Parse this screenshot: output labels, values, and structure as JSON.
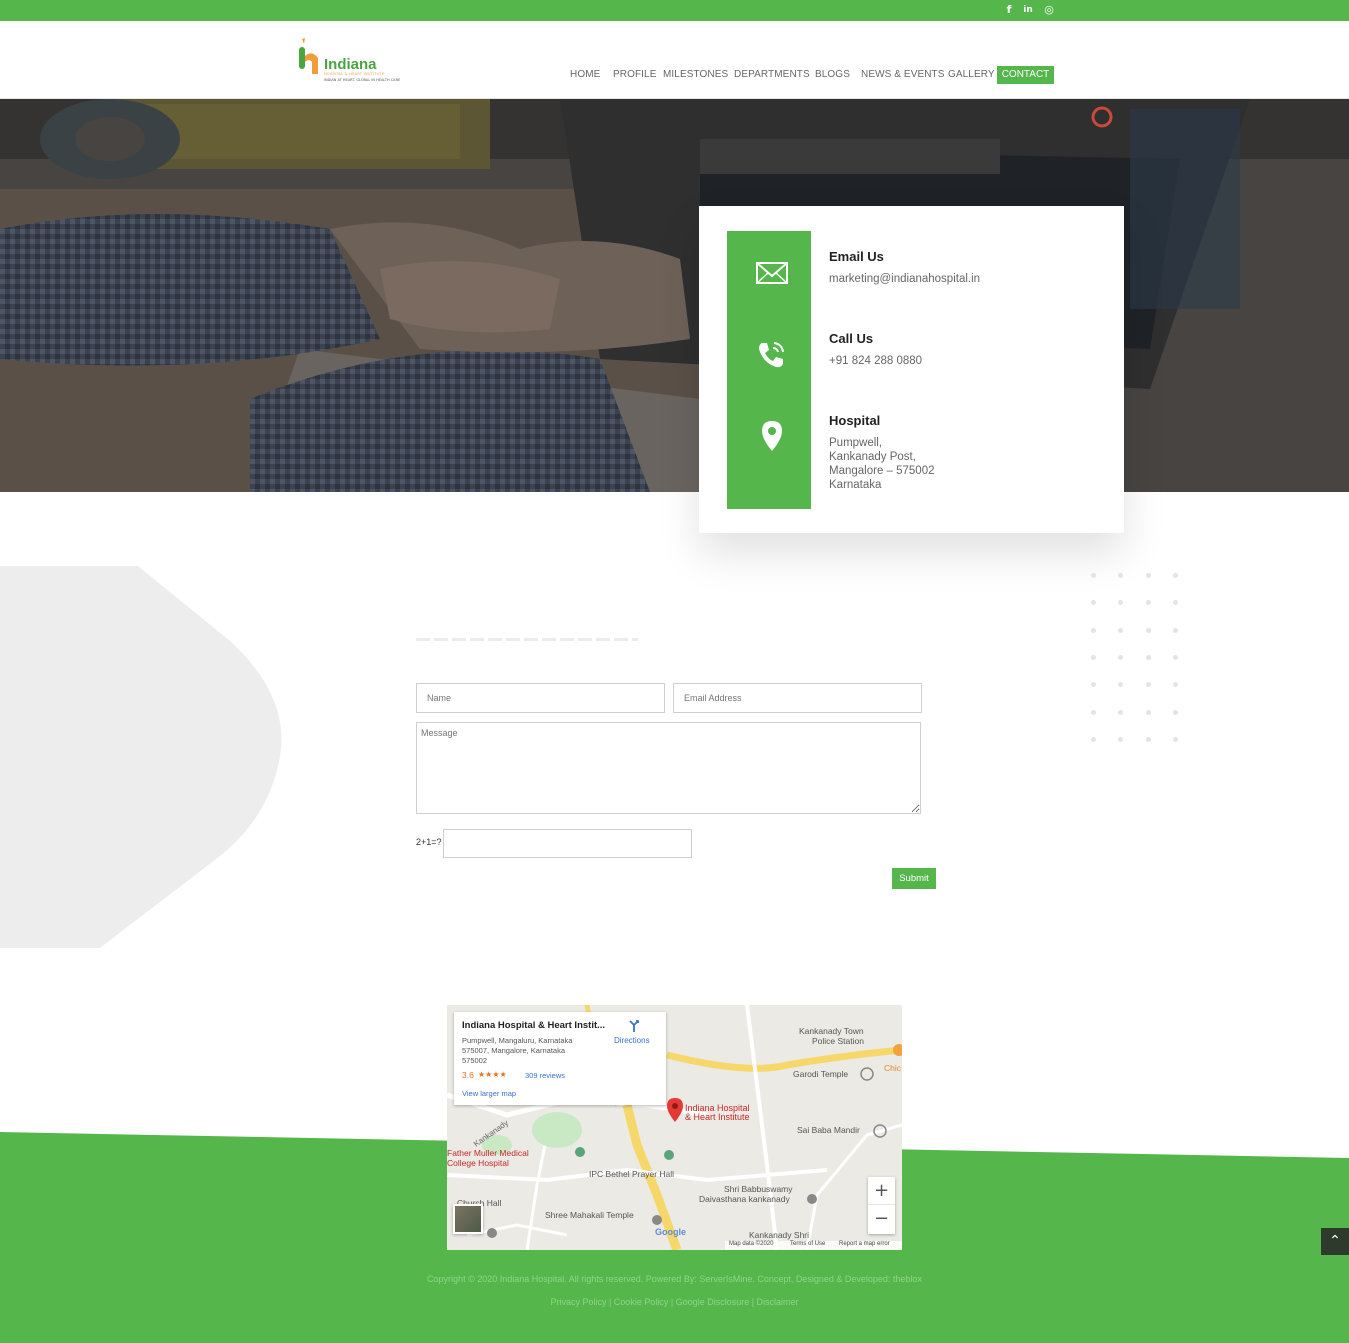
{
  "topbar": {
    "social": [
      {
        "icon": "facebook-icon",
        "glyph": "f"
      },
      {
        "icon": "linkedin-icon",
        "glyph": "in"
      },
      {
        "icon": "instagram-icon",
        "glyph": "◎"
      }
    ]
  },
  "brand": {
    "name": "Indiana",
    "subtitle": "HOSPITAL & HEART INSTITUTE",
    "tagline": "INDIAN AT HEART. GLOBAL IN HEALTH CARE"
  },
  "nav": {
    "items": [
      "HOME",
      "PROFILE",
      "MILESTONES",
      "DEPARTMENTS",
      "BLOGS",
      "NEWS & EVENTS",
      "GALLERY"
    ],
    "active": "CONTACT"
  },
  "contact_info": {
    "email_title": "Email Us",
    "email_value": "marketing@indianahospital.in",
    "call_title": "Call Us",
    "call_value": "+91 824 288 0880",
    "hospital_title": "Hospital",
    "address_lines": [
      "Pumpwell,",
      "Kankanady Post,",
      "Mangalore – 575002",
      "Karnataka"
    ]
  },
  "form": {
    "name_placeholder": "Name",
    "email_placeholder": "Email Address",
    "message_placeholder": "Message",
    "captcha_label": "2+1=?",
    "submit_label": "Submit"
  },
  "map": {
    "place_name": "Indiana Hospital & Heart Instit...",
    "address_line1": "Pumpwell, Mangaluru, Karnataka",
    "address_line2": "575007, Mangalore, Karnataka",
    "address_line3": "575002",
    "rating": "3.6",
    "stars": "★★★★",
    "reviews": "309 reviews",
    "directions": "Directions",
    "view_larger": "View larger map",
    "labels": {
      "pin": "Indiana Hospital",
      "pin2": "& Heart Institute",
      "police": "Kankanady Town",
      "police2": "Police Station",
      "garodi": "Garodi Temple",
      "saibaba": "Sai Baba Mandir",
      "muller": "Father Muller Medical",
      "muller2": "College Hospital",
      "ipc": "IPC Bethel Prayer Hall",
      "babbu": "Shri Babbuswamy",
      "babbu2": "Daivasthana kankanady",
      "mahakali": "Shree Mahakali Temple",
      "church": "Church Hall",
      "kankanady": "Kankanady",
      "kankanady_shri": "Kankanady Shri",
      "chic": "Chic",
      "google": "Google",
      "map_data": "Map data ©2020",
      "terms": "Terms of Use",
      "report": "Report a map error"
    },
    "zoom_in": "+",
    "zoom_out": "−"
  },
  "footer": {
    "copyright": "Copyright © 2020 Indiana Hospital. All rights reserved. Powered By: ServerIsMine. Concept, Designed & Developed: theblox",
    "links": "Privacy Policy | Cookie Policy | Google Disclosure | Disclaimer"
  },
  "colors": {
    "brand_green": "#55b64c",
    "hero_dark": "#3c3a39"
  },
  "back_to_top": "⌃"
}
